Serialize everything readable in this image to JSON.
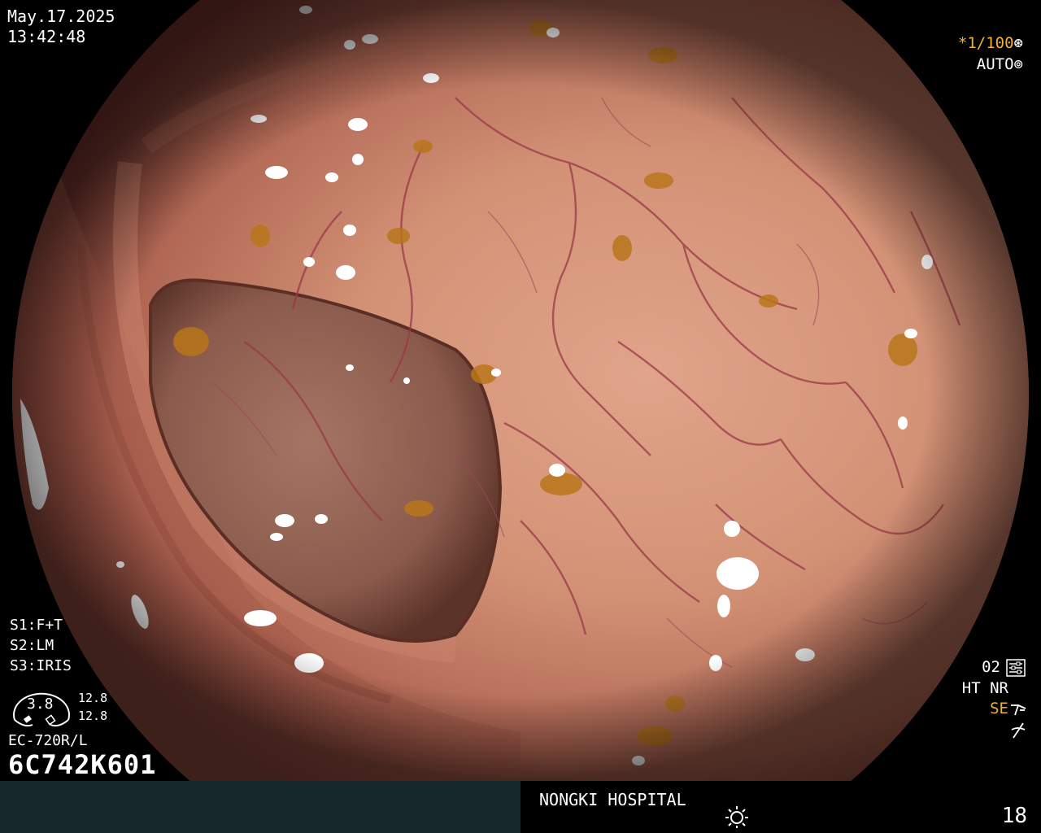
{
  "colors": {
    "overlay_text": "#ffffff",
    "accent_amber": "#f2b030",
    "bottom_bar_left": "#16282c",
    "bottom_bar_right": "#000000",
    "mucosa": "#c9876e",
    "vessel": "#9a3848",
    "debris": "#b8761a"
  },
  "header": {
    "date": "May.17.2025",
    "time": "13:42:48"
  },
  "right_top": {
    "shutter": "*1/100",
    "shutter_icon": "aperture-icon",
    "auto": "AUTO",
    "auto_icon": "iris-icon"
  },
  "left_panel": {
    "s1": "S1:F+T",
    "s2": "S2:LM",
    "s3": "S3:IRIS",
    "zoom": "3.8",
    "diam_top": "12.8",
    "diam_bottom": "12.8",
    "model": "EC-720R/L",
    "serial": "6C742K601"
  },
  "right_panel": {
    "o2": "02",
    "o2_icon": "settings-icon",
    "ht_nr": "HT NR",
    "se": "SE",
    "se_icon": "enhancement-icon",
    "scope_icon": "scope-icon"
  },
  "footer": {
    "hospital": "NONGKI HOSPITAL",
    "light_icon": "light-icon",
    "frame": "18"
  }
}
